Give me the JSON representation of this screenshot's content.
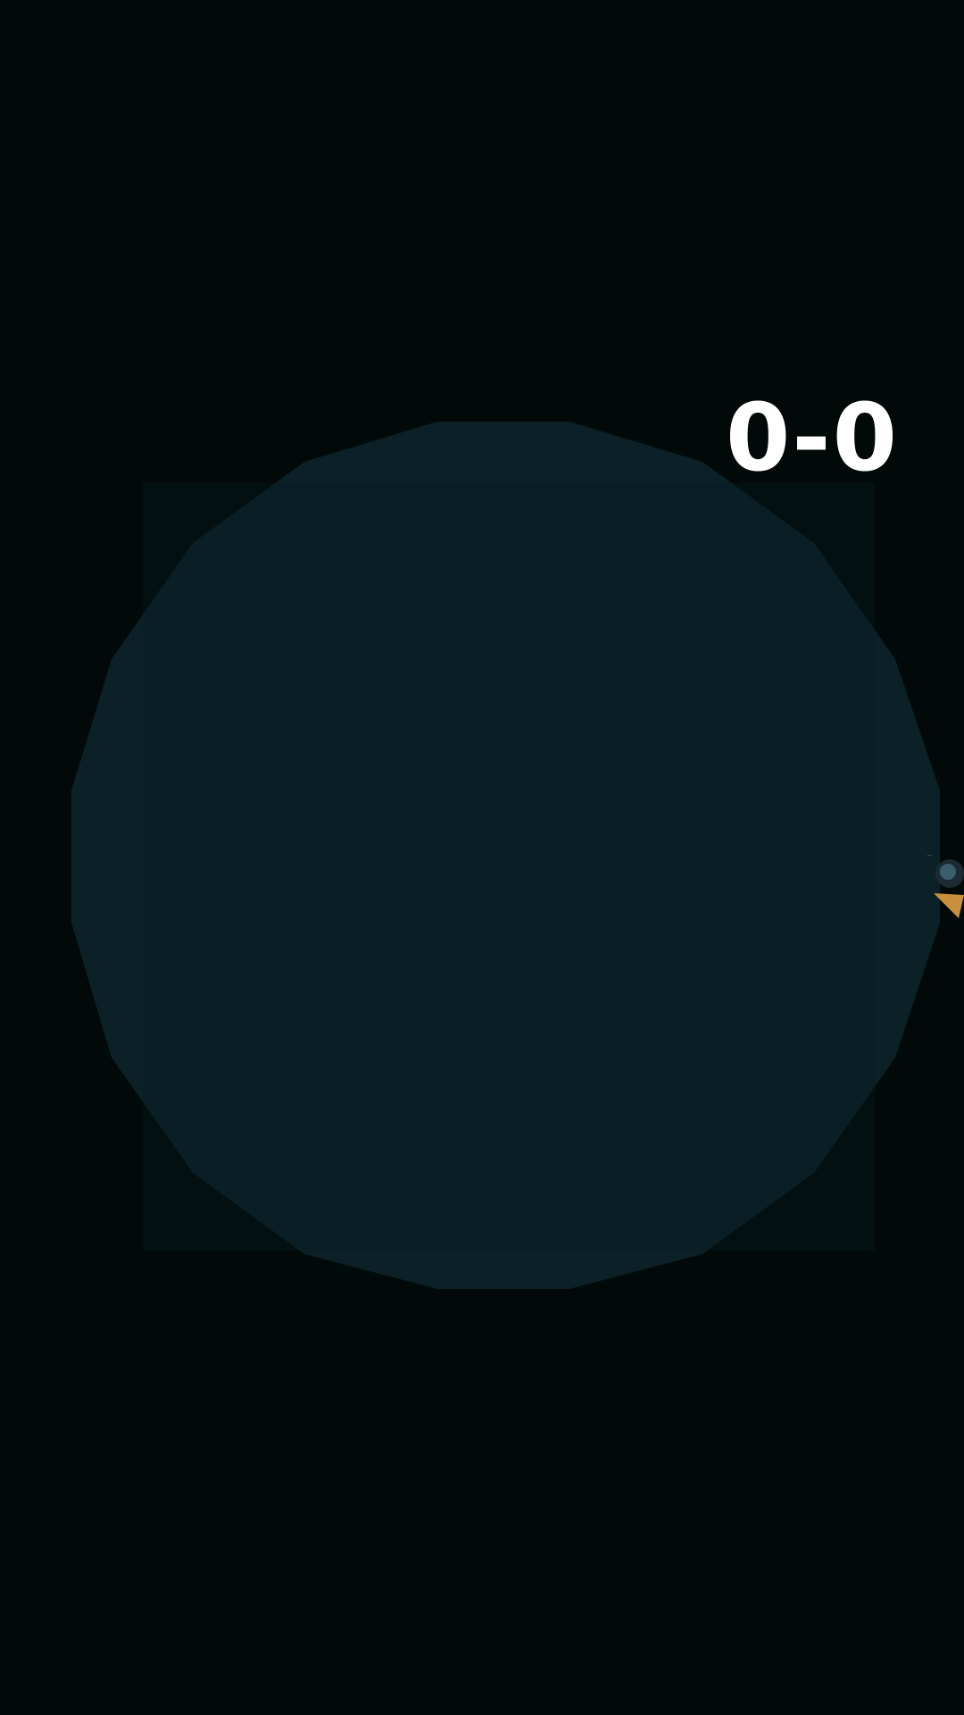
{
  "score": {
    "text": "0-0"
  },
  "colors": {
    "background": "#010a08",
    "arena_fill": "#0b2127",
    "score_text": "#ffffff",
    "player_hair": "#1b2b33",
    "player_body": "#c8903c"
  },
  "arena": {
    "shape": "polygon",
    "sides": 20
  },
  "player": {
    "icon": "player-character-icon"
  }
}
